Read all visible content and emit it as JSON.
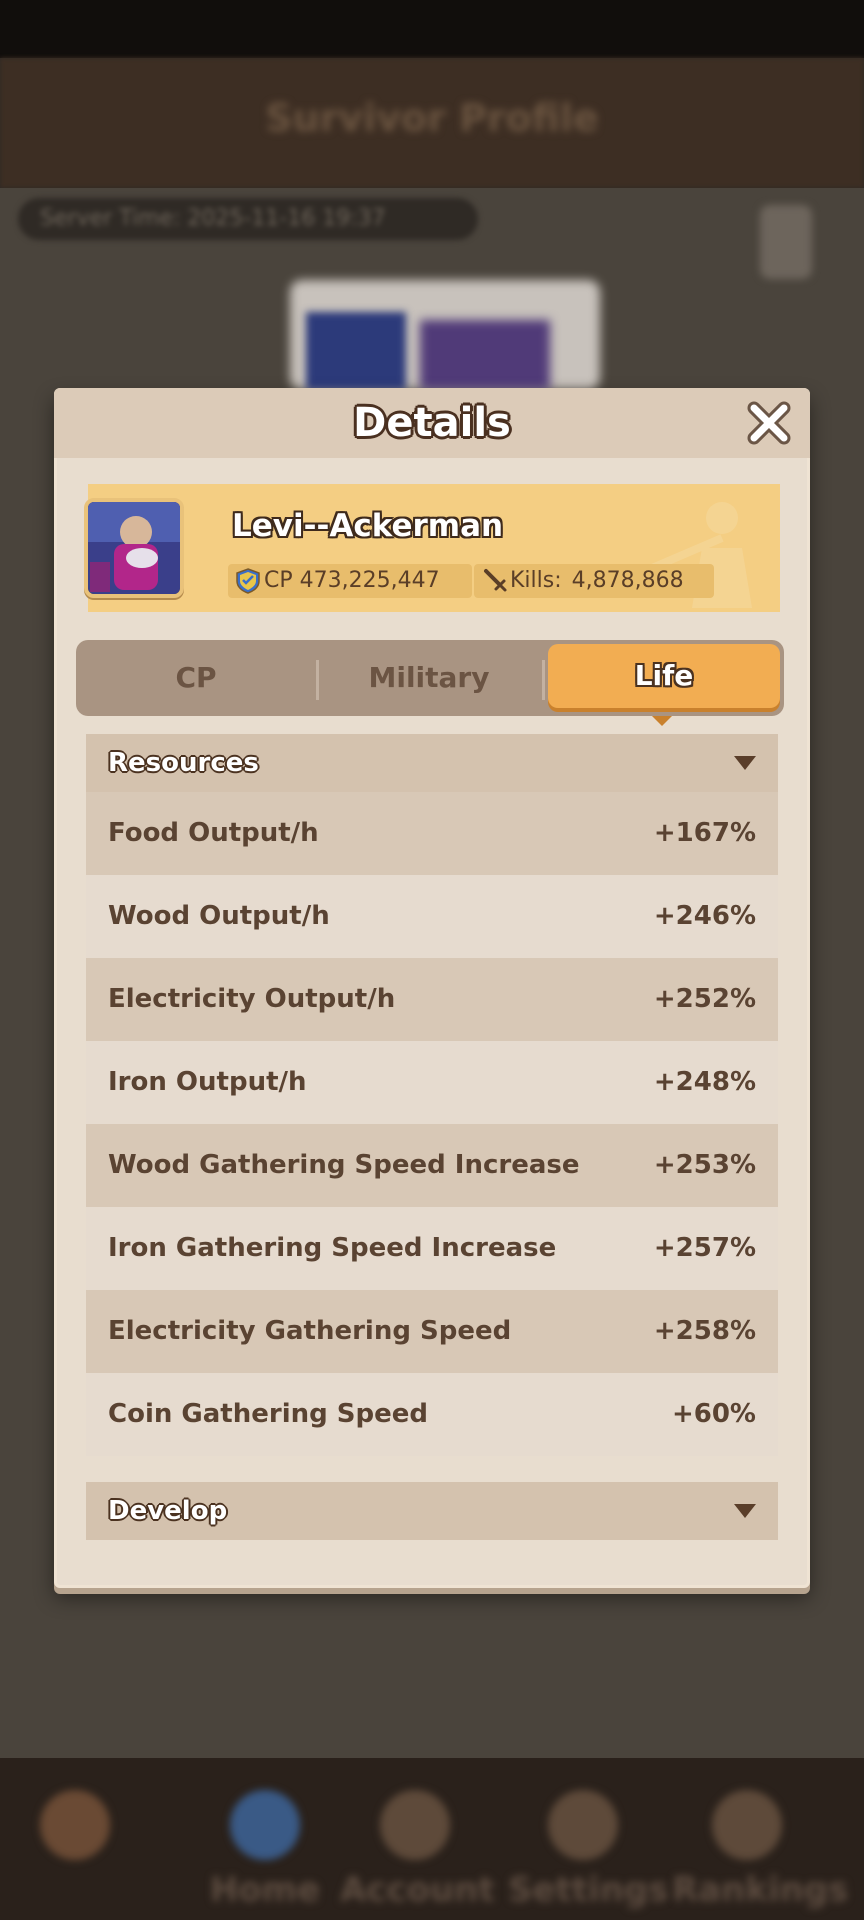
{
  "background": {
    "screen_title": "Survivor Profile",
    "server_time_label": "Server Time: 2025-11-16 19:37",
    "bottom_nav": [
      "Home",
      "Account",
      "Settings",
      "Rankings"
    ]
  },
  "details": {
    "title": "Details",
    "player": {
      "name": "Levi--Ackerman",
      "cp": "CP 473,225,447",
      "kills_label": "Kills:",
      "kills_value": "4,878,868"
    },
    "tabs": [
      {
        "label": "CP",
        "active": false
      },
      {
        "label": "Military",
        "active": false
      },
      {
        "label": "Life",
        "active": true
      }
    ],
    "sections": {
      "resources": {
        "title": "Resources",
        "rows": [
          {
            "label": "Food Output/h",
            "value": "+167%"
          },
          {
            "label": "Wood Output/h",
            "value": "+246%"
          },
          {
            "label": "Electricity Output/h",
            "value": "+252%"
          },
          {
            "label": "Iron Output/h",
            "value": "+248%"
          },
          {
            "label": "Wood Gathering Speed Increase",
            "value": "+253%"
          },
          {
            "label": "Iron Gathering Speed Increase",
            "value": "+257%"
          },
          {
            "label": "Electricity Gathering Speed",
            "value": "+258%"
          },
          {
            "label": "Coin Gathering Speed",
            "value": "+60%"
          }
        ]
      },
      "develop": {
        "title": "Develop"
      }
    }
  },
  "colors": {
    "active_tab": "#f2ad52",
    "banner": "#f4ce83",
    "text": "#5a4332"
  },
  "icons": [
    "close-icon",
    "shield-icon",
    "sword-icon",
    "caret-down-icon"
  ]
}
